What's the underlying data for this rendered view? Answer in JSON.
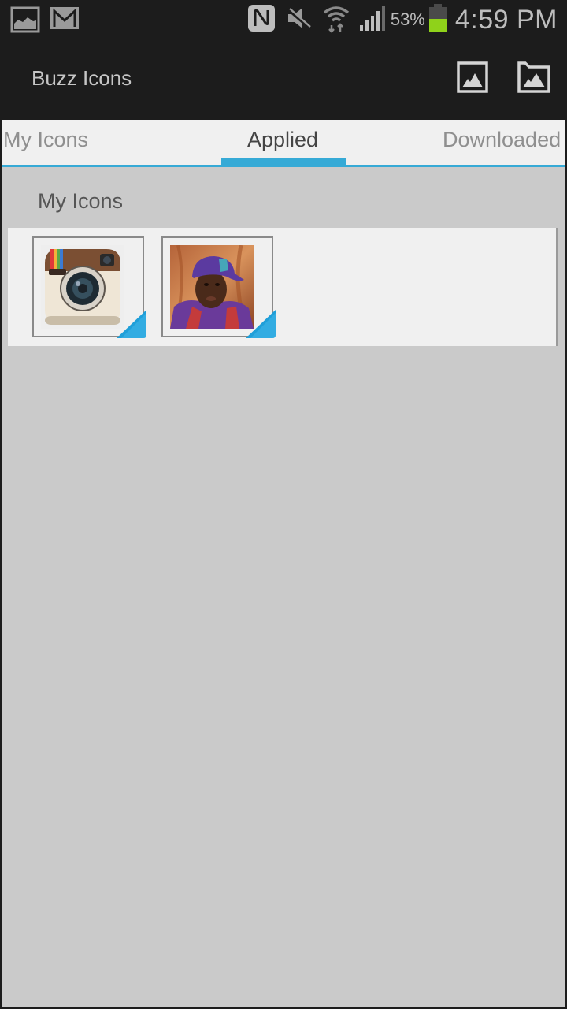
{
  "status_bar": {
    "left_icons": [
      "gallery-notification-icon",
      "gmail-notification-icon"
    ],
    "right_icons": [
      "nfc-icon",
      "mute-icon",
      "wifi-icon",
      "signal-icon",
      "battery-icon"
    ],
    "battery_percent": "53%",
    "battery_level": 0.53,
    "battery_color": "#8fd21a",
    "time": "4:59 PM"
  },
  "action_bar": {
    "title": "Buzz Icons",
    "actions": [
      {
        "name": "image-icon",
        "label": "Pick image"
      },
      {
        "name": "folder-image-icon",
        "label": "Pick from folder"
      }
    ]
  },
  "tabs": {
    "items": [
      {
        "label": "My Icons",
        "selected": false
      },
      {
        "label": "Applied",
        "selected": true
      },
      {
        "label": "Downloaded",
        "selected": false
      }
    ],
    "accent": "#36aad6"
  },
  "content": {
    "section_title": "My Icons",
    "icons": [
      {
        "name": "instagram-icon",
        "description": "Instagram camera icon"
      },
      {
        "name": "person-photo-icon",
        "description": "Photo of person in purple cap"
      }
    ],
    "corner_color": "#1f9fd9"
  }
}
